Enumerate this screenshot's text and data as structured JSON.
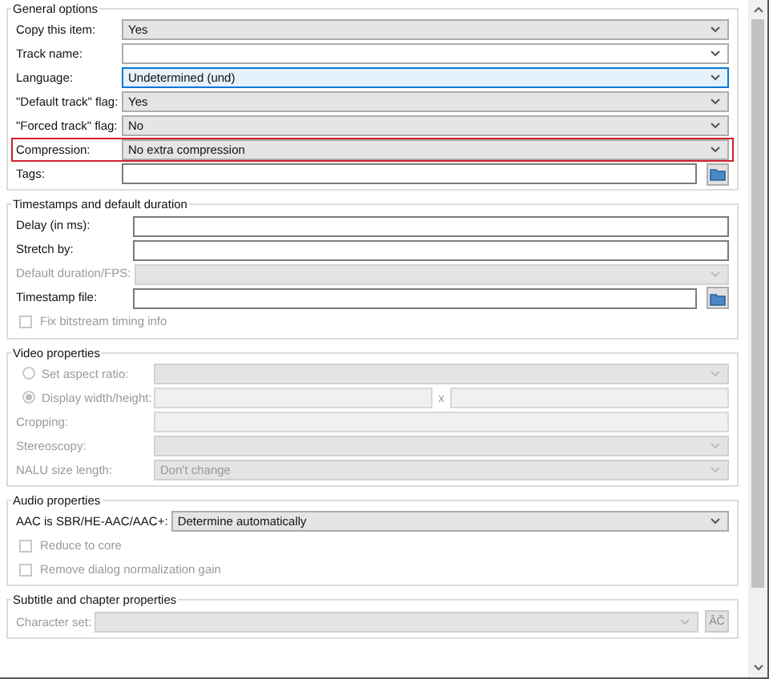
{
  "sections": [
    {
      "title": "General options",
      "rows": [
        {
          "kind": "select",
          "label": "Copy this item:",
          "value": "Yes",
          "disabled": false
        },
        {
          "kind": "combo",
          "label": "Track name:",
          "disabled": false
        },
        {
          "kind": "combo",
          "label": "Language:",
          "value": "Undetermined (und)",
          "disabled": false,
          "focused": true
        },
        {
          "kind": "select",
          "label": "\"Default track\" flag:",
          "value": "Yes",
          "disabled": false
        },
        {
          "kind": "select",
          "label": "\"Forced track\" flag:",
          "value": "No",
          "disabled": false
        },
        {
          "kind": "select",
          "label": "Compression:",
          "value": "No extra compression",
          "disabled": false,
          "highlighted": true
        },
        {
          "kind": "file",
          "label": "Tags:",
          "disabled": false
        }
      ]
    },
    {
      "title": "Timestamps and default duration",
      "rows": [
        {
          "kind": "input",
          "label": "Delay (in ms):",
          "disabled": false
        },
        {
          "kind": "input",
          "label": "Stretch by:",
          "disabled": false
        },
        {
          "kind": "select",
          "label": "Default duration/FPS:",
          "disabled": true
        },
        {
          "kind": "file",
          "label": "Timestamp file:",
          "disabled": false
        },
        {
          "kind": "checkbox",
          "label": "Fix bitstream timing info",
          "disabled": true,
          "checked": false
        }
      ]
    },
    {
      "title": "Video properties",
      "rows": [
        {
          "kind": "radio_select",
          "label": "Set aspect ratio:",
          "disabled": true,
          "selected": false
        },
        {
          "kind": "radio_pair",
          "label": "Display width/height:",
          "separator": "x",
          "disabled": true,
          "selected": true
        },
        {
          "kind": "input",
          "label": "Cropping:",
          "disabled": true
        },
        {
          "kind": "select",
          "label": "Stereoscopy:",
          "disabled": true
        },
        {
          "kind": "select",
          "label": "NALU size length:",
          "value": "Don't change",
          "disabled": true
        }
      ]
    },
    {
      "title": "Audio properties",
      "rows": [
        {
          "kind": "select",
          "label": "AAC is SBR/HE-AAC/AAC+:",
          "value": "Determine automatically",
          "disabled": false
        },
        {
          "kind": "checkbox",
          "label": "Reduce to core",
          "disabled": true,
          "checked": false
        },
        {
          "kind": "checkbox",
          "label": "Remove dialog normalization gain",
          "disabled": true,
          "checked": false
        }
      ]
    },
    {
      "title": "Subtitle and chapter properties",
      "rows": [
        {
          "kind": "charset",
          "label": "Character set:",
          "button_text": "ÂČ",
          "disabled": true
        }
      ]
    }
  ]
}
